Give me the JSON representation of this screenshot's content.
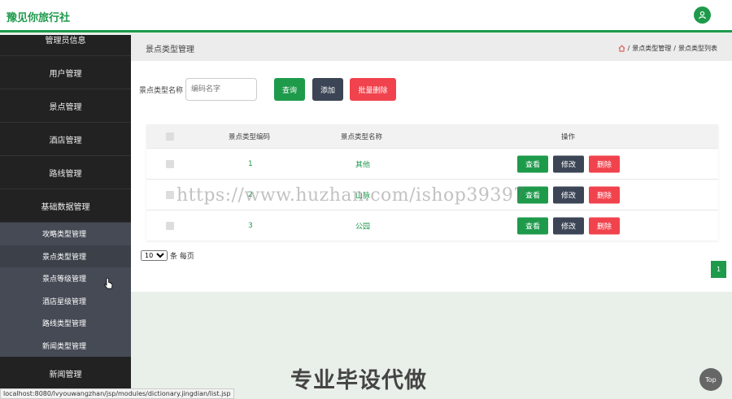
{
  "header": {
    "brand": "豫见你旅行社",
    "avatar_icon": "user-icon"
  },
  "sidebar": {
    "items": [
      {
        "label": "管理员信息"
      },
      {
        "label": "用户管理"
      },
      {
        "label": "景点管理"
      },
      {
        "label": "酒店管理"
      },
      {
        "label": "路线管理"
      },
      {
        "label": "基础数据管理"
      }
    ],
    "submenu": [
      {
        "label": "攻略类型管理"
      },
      {
        "label": "景点类型管理"
      },
      {
        "label": "景点等级管理"
      },
      {
        "label": "酒店星级管理"
      },
      {
        "label": "路线类型管理"
      },
      {
        "label": "新闻类型管理"
      }
    ],
    "after": [
      {
        "label": "新闻管理"
      }
    ]
  },
  "page": {
    "title": "景点类型管理",
    "breadcrumb": [
      "景点类型管理",
      "景点类型列表"
    ],
    "breadcrumb_sep": "/"
  },
  "search": {
    "label": "景点类型名称",
    "placeholder": "编码名字",
    "query_label": "查询",
    "add_label": "添加",
    "batch_delete_label": "批量删除"
  },
  "table": {
    "headers": {
      "code": "景点类型编码",
      "name": "景点类型名称",
      "ops": "操作"
    },
    "rows": [
      {
        "code": "1",
        "name": "其他"
      },
      {
        "code": "2",
        "name": "山脉"
      },
      {
        "code": "3",
        "name": "公园"
      }
    ],
    "op_labels": {
      "view": "查看",
      "edit": "修改",
      "delete": "删除"
    }
  },
  "pager": {
    "page_size": "10",
    "page_size_suffix": "条 每页",
    "current_page": "1"
  },
  "colors": {
    "accent": "#1e9a4b",
    "dark": "#3b4555",
    "danger": "#f0434d",
    "sidebar": "#222222"
  },
  "overlay": {
    "watermark": "https://www.huzhan.com/ishop39397",
    "bottom_text": "专业毕设代做",
    "status_url": "localhost:8080/lvyouwangzhan/jsp/modules/dictionary.jingdian/list.jsp",
    "top_label": "Top"
  }
}
